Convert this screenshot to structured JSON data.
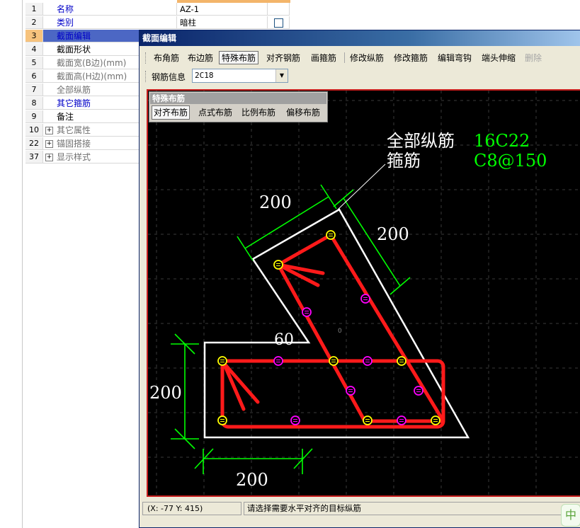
{
  "properties": [
    {
      "num": "1",
      "name": "名称",
      "value": "AZ-1",
      "style": "blue",
      "expand": false,
      "check": false,
      "selected": false
    },
    {
      "num": "2",
      "name": "类别",
      "value": "暗柱",
      "style": "blue",
      "expand": false,
      "check": true,
      "selected": false
    },
    {
      "num": "3",
      "name": "截面编辑",
      "value": "",
      "style": "blue",
      "expand": false,
      "check": false,
      "selected": true
    },
    {
      "num": "4",
      "name": "截面形状",
      "value": "",
      "style": "black",
      "expand": false,
      "check": false,
      "selected": false
    },
    {
      "num": "5",
      "name": "截面宽(B边)(mm)",
      "value": "",
      "style": "gray",
      "expand": false,
      "check": false,
      "selected": false
    },
    {
      "num": "6",
      "name": "截面高(H边)(mm)",
      "value": "",
      "style": "gray",
      "expand": false,
      "check": false,
      "selected": false
    },
    {
      "num": "7",
      "name": "全部纵筋",
      "value": "",
      "style": "gray",
      "expand": false,
      "check": false,
      "selected": false
    },
    {
      "num": "8",
      "name": "其它箍筋",
      "value": "",
      "style": "blue",
      "expand": false,
      "check": false,
      "selected": false
    },
    {
      "num": "9",
      "name": "备注",
      "value": "",
      "style": "black",
      "expand": false,
      "check": false,
      "selected": false
    },
    {
      "num": "10",
      "name": "其它属性",
      "value": "",
      "style": "gray",
      "expand": true,
      "check": false,
      "selected": false
    },
    {
      "num": "22",
      "name": "锚固搭接",
      "value": "",
      "style": "gray",
      "expand": true,
      "check": false,
      "selected": false
    },
    {
      "num": "37",
      "name": "显示样式",
      "value": "",
      "style": "gray",
      "expand": true,
      "check": false,
      "selected": false
    }
  ],
  "dialog": {
    "title": "截面编辑",
    "toolbar": {
      "buttons": [
        {
          "label": "布角筋",
          "state": "normal"
        },
        {
          "label": "布边筋",
          "state": "normal"
        },
        {
          "label": "特殊布筋",
          "state": "active"
        },
        {
          "label": "对齐钢筋",
          "state": "normal"
        },
        {
          "label": "画箍筋",
          "state": "normal"
        },
        {
          "label": "修改纵筋",
          "state": "normal"
        },
        {
          "label": "修改箍筋",
          "state": "normal"
        },
        {
          "label": "编辑弯钩",
          "state": "normal"
        },
        {
          "label": "端头伸缩",
          "state": "normal"
        },
        {
          "label": "删除",
          "state": "disabled"
        }
      ]
    },
    "rebar_info": {
      "label": "钢筋信息",
      "value": "2C18"
    },
    "special_panel": {
      "title": "特殊布筋",
      "buttons": [
        {
          "label": "对齐布筋",
          "state": "active"
        },
        {
          "label": "点式布筋",
          "state": "normal"
        },
        {
          "label": "比例布筋",
          "state": "normal"
        },
        {
          "label": "偏移布筋",
          "state": "normal"
        }
      ]
    },
    "drawing": {
      "annotations": {
        "longitudinal_label": "全部纵筋",
        "longitudinal_value": "16C22",
        "stirrup_label": "箍筋",
        "stirrup_value": "C8@150"
      },
      "dimensions": {
        "top_left": "200",
        "top_right": "200",
        "left_height": "200",
        "bottom_width": "200",
        "angle": "60"
      },
      "origin_label": "0",
      "colors": {
        "background": "#000000",
        "concrete": "#ffffff",
        "stirrup": "#ff1a1a",
        "dimension": "#00ff00",
        "bar_yellow": "#ffff00",
        "bar_magenta": "#ff00ff",
        "annotation_value": "#00ff00",
        "annotation_label": "#ffffff"
      }
    },
    "status": {
      "coords": "(X: -77 Y: 415)",
      "message": "请选择需要水平对齐的目标纵筋"
    }
  },
  "ime_icon": "中"
}
